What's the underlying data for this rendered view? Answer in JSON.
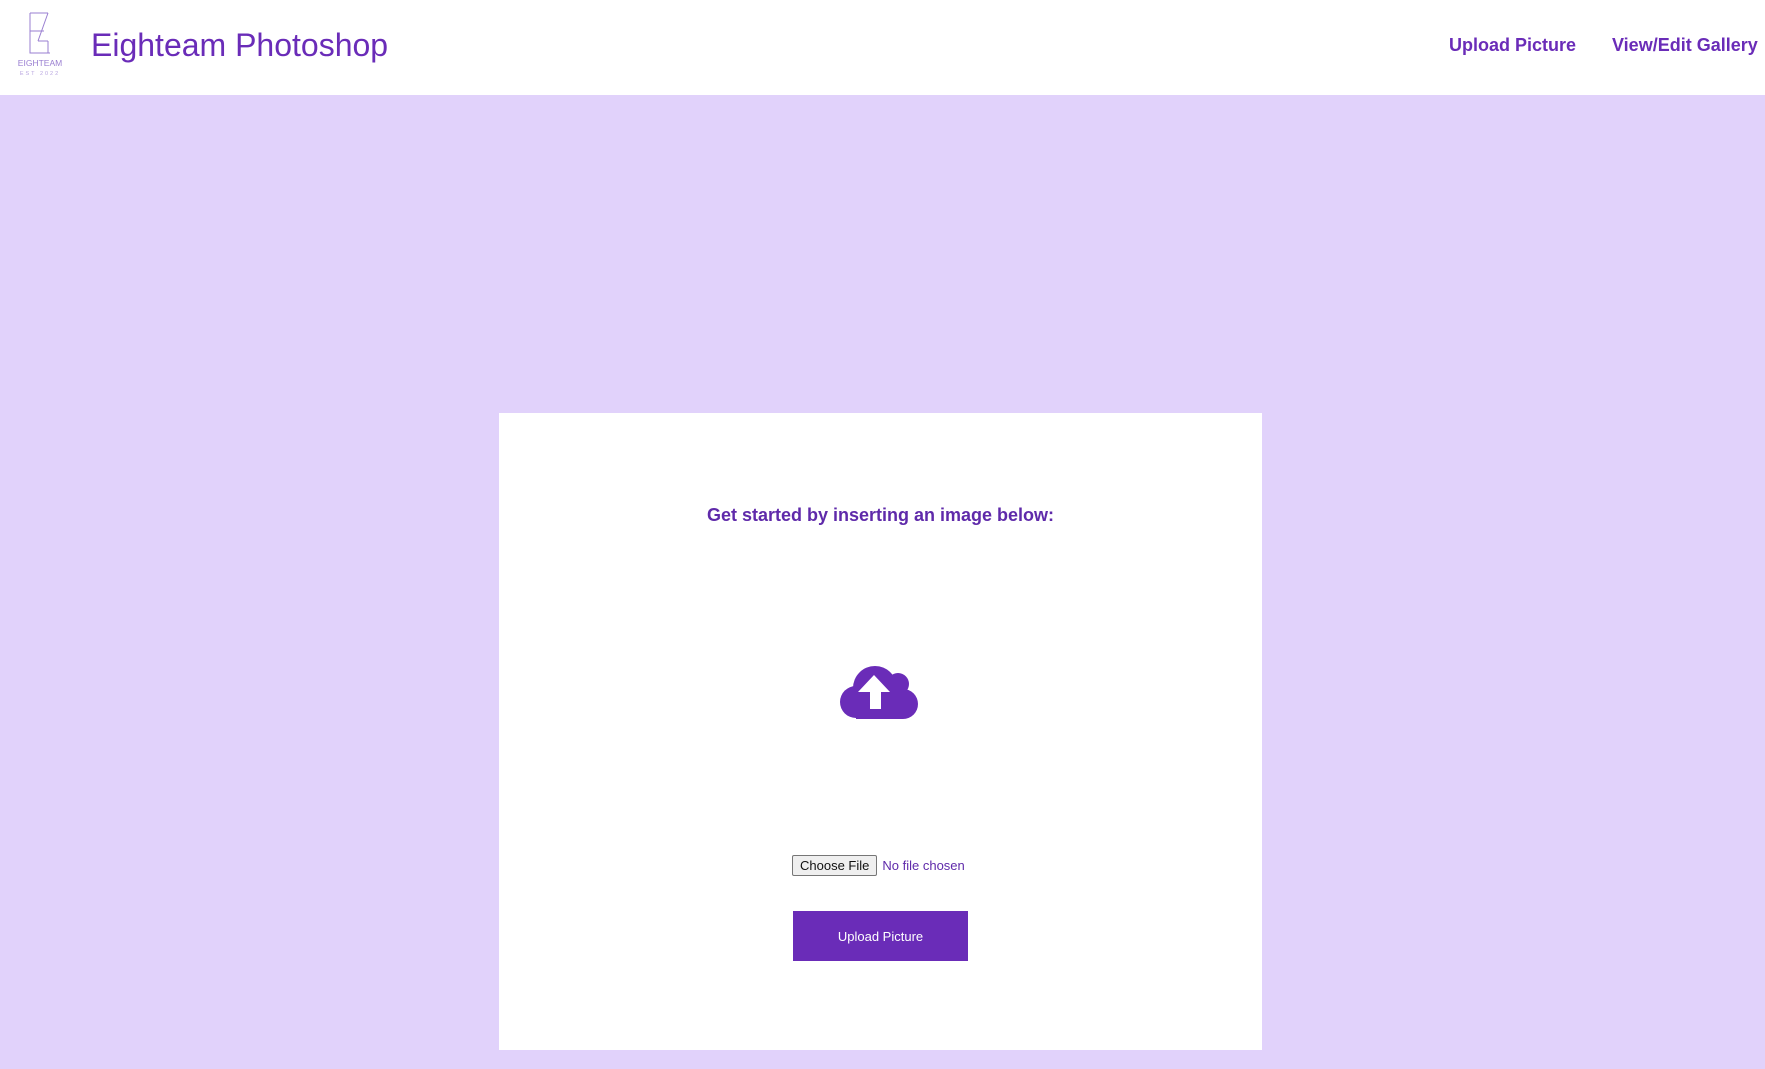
{
  "header": {
    "logo": {
      "icon": "eighteam-logo",
      "text": "EIGHTEAM",
      "subtext": "EST 2022"
    },
    "title": "Eighteam Photoshop",
    "nav": [
      {
        "label": "Upload Picture"
      },
      {
        "label": "View/Edit Gallery"
      }
    ]
  },
  "upload_card": {
    "prompt": "Get started by inserting an image below:",
    "icon": "cloud-upload-icon",
    "file_input": {
      "button_label": "Choose File",
      "status": "No file chosen"
    },
    "submit_label": "Upload Picture"
  },
  "colors": {
    "page_background": "#e1d2fb",
    "accent": "#6a2cb8",
    "card_background": "#ffffff",
    "header_background": "#ffffff"
  }
}
